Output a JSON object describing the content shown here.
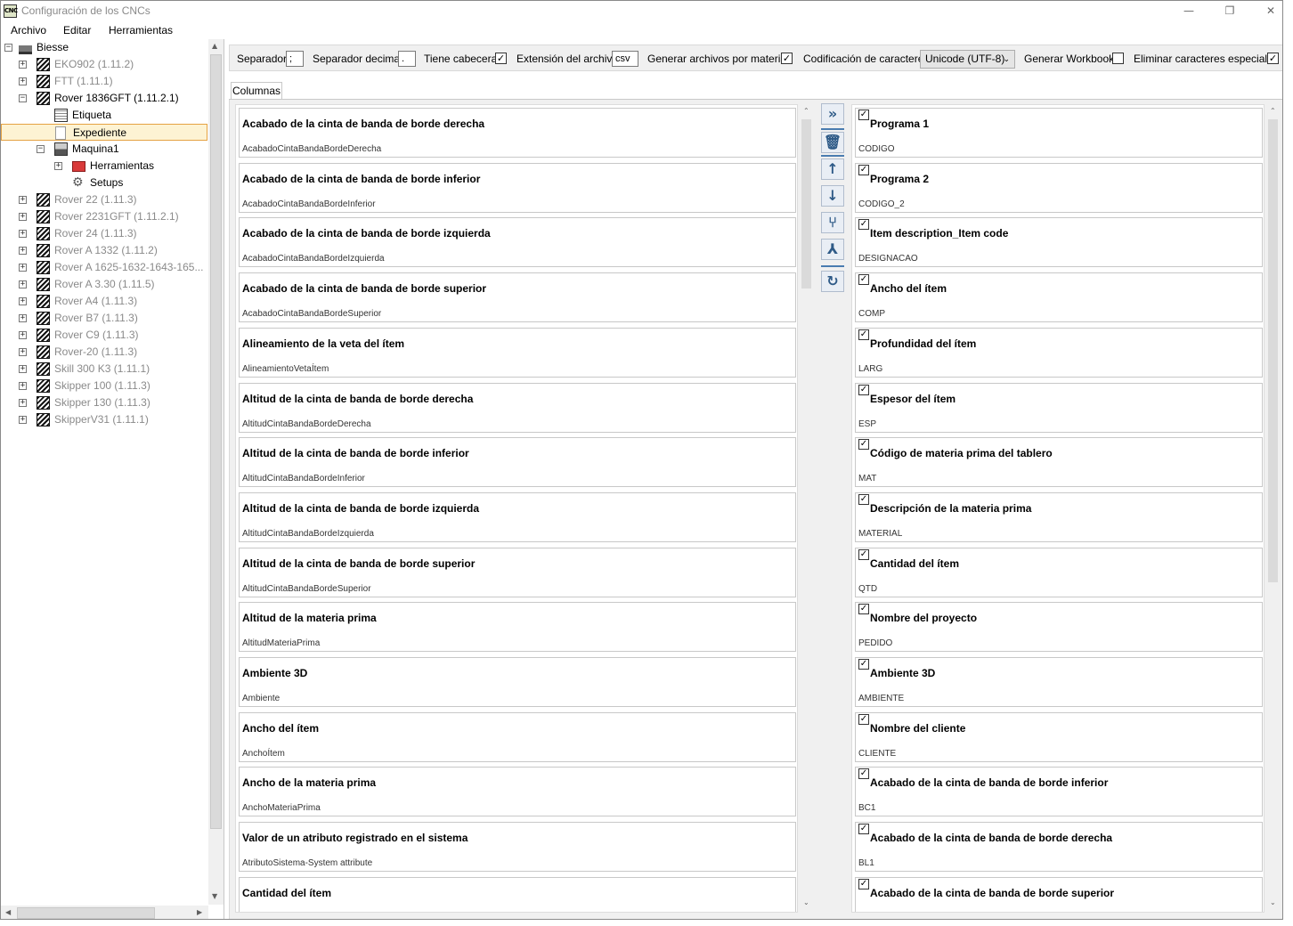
{
  "window": {
    "title": "Configuración de los CNCs",
    "icon_text": "CNC",
    "minimize": "—",
    "restore": "❐",
    "close": "✕"
  },
  "menu": [
    "Archivo",
    "Editar",
    "Herramientas"
  ],
  "tree": [
    {
      "label": "Biesse",
      "level": 0,
      "expander": "⊟",
      "icon": "factory-icon",
      "grey": false
    },
    {
      "label": "EKO902 (1.11.2)",
      "level": 1,
      "expander": "+",
      "icon": "machine-icon",
      "grey": true
    },
    {
      "label": "FTT (1.11.1)",
      "level": 1,
      "expander": "+",
      "icon": "machine-icon",
      "grey": true
    },
    {
      "label": "Rover 1836GFT (1.11.2.1)",
      "level": 1,
      "expander": "−",
      "icon": "machine-icon",
      "grey": false
    },
    {
      "label": "Etiqueta",
      "level": 2,
      "expander": "",
      "icon": "label-icon",
      "grey": false
    },
    {
      "label": "Expediente",
      "level": 2,
      "expander": "",
      "icon": "document-icon",
      "grey": false,
      "selected": true
    },
    {
      "label": "Maquina1",
      "level": 2,
      "expander": "−",
      "icon": "machine-small-icon",
      "grey": false
    },
    {
      "label": "Herramientas",
      "level": 3,
      "expander": "+",
      "icon": "toolbox-icon",
      "grey": false
    },
    {
      "label": "Setups",
      "level": 3,
      "expander": "",
      "icon": "gear-icon",
      "grey": false
    },
    {
      "label": "Rover 22 (1.11.3)",
      "level": 1,
      "expander": "+",
      "icon": "machine-icon",
      "grey": true
    },
    {
      "label": "Rover 2231GFT (1.11.2.1)",
      "level": 1,
      "expander": "+",
      "icon": "machine-icon",
      "grey": true
    },
    {
      "label": "Rover 24 (1.11.3)",
      "level": 1,
      "expander": "+",
      "icon": "machine-icon",
      "grey": true
    },
    {
      "label": "Rover A 1332 (1.11.2)",
      "level": 1,
      "expander": "+",
      "icon": "machine-icon",
      "grey": true
    },
    {
      "label": "Rover A 1625-1632-1643-165...",
      "level": 1,
      "expander": "+",
      "icon": "machine-icon",
      "grey": true
    },
    {
      "label": "Rover A 3.30 (1.11.5)",
      "level": 1,
      "expander": "+",
      "icon": "machine-icon",
      "grey": true
    },
    {
      "label": "Rover A4 (1.11.3)",
      "level": 1,
      "expander": "+",
      "icon": "machine-icon",
      "grey": true
    },
    {
      "label": "Rover B7 (1.11.3)",
      "level": 1,
      "expander": "+",
      "icon": "machine-icon",
      "grey": true
    },
    {
      "label": "Rover C9 (1.11.3)",
      "level": 1,
      "expander": "+",
      "icon": "machine-icon",
      "grey": true
    },
    {
      "label": "Rover-20 (1.11.3)",
      "level": 1,
      "expander": "+",
      "icon": "machine-icon",
      "grey": true
    },
    {
      "label": "Skill 300 K3 (1.11.1)",
      "level": 1,
      "expander": "+",
      "icon": "machine-icon",
      "grey": true
    },
    {
      "label": "Skipper 100 (1.11.3)",
      "level": 1,
      "expander": "+",
      "icon": "machine-icon",
      "grey": true
    },
    {
      "label": "Skipper 130 (1.11.3)",
      "level": 1,
      "expander": "+",
      "icon": "machine-icon",
      "grey": true
    },
    {
      "label": "SkipperV31 (1.11.1)",
      "level": 1,
      "expander": "+",
      "icon": "machine-icon",
      "grey": true
    }
  ],
  "toolbar": {
    "separator_label": "Separador",
    "separator_value": ";",
    "decimal_label": "Separador decimal",
    "decimal_value": ".",
    "header_label": "Tiene cabecera",
    "header_checked": true,
    "extension_label": "Extensión del archivo",
    "extension_value": "csv",
    "per_material_label": "Generar archivos por material",
    "per_material_checked": true,
    "encoding_label": "Codificación de caracteres",
    "encoding_value": "Unicode (UTF-8)",
    "workbook_label": "Generar Workbook",
    "workbook_checked": false,
    "special_label": "Eliminar caracteres especiales",
    "special_checked": true
  },
  "tabs": [
    "Columnas"
  ],
  "available_columns": [
    {
      "title": "Acabado de la cinta de banda de borde derecha",
      "key": "AcabadoCintaBandaBordeDerecha"
    },
    {
      "title": "Acabado de la cinta de banda de borde inferior",
      "key": "AcabadoCintaBandaBordeInferior"
    },
    {
      "title": "Acabado de la cinta de banda de borde izquierda",
      "key": "AcabadoCintaBandaBordeIzquierda"
    },
    {
      "title": "Acabado de la cinta de banda de borde superior",
      "key": "AcabadoCintaBandaBordeSuperior"
    },
    {
      "title": "Alineamiento de la veta del ítem",
      "key": "AlineamientoVetaÍtem"
    },
    {
      "title": "Altitud de la cinta de banda de borde derecha",
      "key": "AltitudCintaBandaBordeDerecha"
    },
    {
      "title": "Altitud de la cinta de banda de borde inferior",
      "key": "AltitudCintaBandaBordeInferior"
    },
    {
      "title": "Altitud de la cinta de banda de borde izquierda",
      "key": "AltitudCintaBandaBordeIzquierda"
    },
    {
      "title": "Altitud de la cinta de banda de borde superior",
      "key": "AltitudCintaBandaBordeSuperior"
    },
    {
      "title": "Altitud de la materia prima",
      "key": "AltitudMateriaPrima"
    },
    {
      "title": "Ambiente 3D",
      "key": "Ambiente"
    },
    {
      "title": "Ancho del ítem",
      "key": "AnchoÍtem"
    },
    {
      "title": "Ancho de la materia prima",
      "key": "AnchoMateriaPrima"
    },
    {
      "title": "Valor de un atributo registrado en el sistema",
      "key": "AtributoSistema-System attribute"
    },
    {
      "title": "Cantidad del ítem",
      "key": ""
    }
  ],
  "actions": [
    {
      "name": "add-all-icon",
      "glyph": "»"
    },
    {
      "name": "delete-icon",
      "glyph": "🗑"
    },
    {
      "name": "move-up-icon",
      "glyph": "↑"
    },
    {
      "name": "move-down-icon",
      "glyph": "↓"
    },
    {
      "name": "merge-icon",
      "glyph": "⑂"
    },
    {
      "name": "split-icon",
      "glyph": "⅄"
    },
    {
      "name": "refresh-icon",
      "glyph": "↻"
    }
  ],
  "selected_columns": [
    {
      "title": "Programa 1",
      "key": "CODIGO",
      "checked": true
    },
    {
      "title": "Programa 2",
      "key": "CODIGO_2",
      "checked": true
    },
    {
      "title": "Item description_Item code",
      "key": "DESIGNACAO",
      "checked": true
    },
    {
      "title": "Ancho del ítem",
      "key": "COMP",
      "checked": true
    },
    {
      "title": "Profundidad del ítem",
      "key": "LARG",
      "checked": true
    },
    {
      "title": "Espesor del ítem",
      "key": "ESP",
      "checked": true
    },
    {
      "title": "Código de materia prima del tablero",
      "key": "MAT",
      "checked": true
    },
    {
      "title": "Descripción de la materia prima",
      "key": "MATERIAL",
      "checked": true
    },
    {
      "title": "Cantidad del ítem",
      "key": "QTD",
      "checked": true
    },
    {
      "title": "Nombre del proyecto",
      "key": "PEDIDO",
      "checked": true
    },
    {
      "title": "Ambiente 3D",
      "key": "AMBIENTE",
      "checked": true
    },
    {
      "title": "Nombre del cliente",
      "key": "CLIENTE",
      "checked": true
    },
    {
      "title": "Acabado de la cinta de banda de borde inferior",
      "key": "BC1",
      "checked": true
    },
    {
      "title": "Acabado de la cinta de banda de borde derecha",
      "key": "BL1",
      "checked": true
    },
    {
      "title": "Acabado de la cinta de banda de borde superior",
      "key": "",
      "checked": true
    }
  ],
  "colors": {
    "selection_bg": "#fdf3d3",
    "selection_border": "#e5a243",
    "action_blue": "#2e5a87"
  }
}
